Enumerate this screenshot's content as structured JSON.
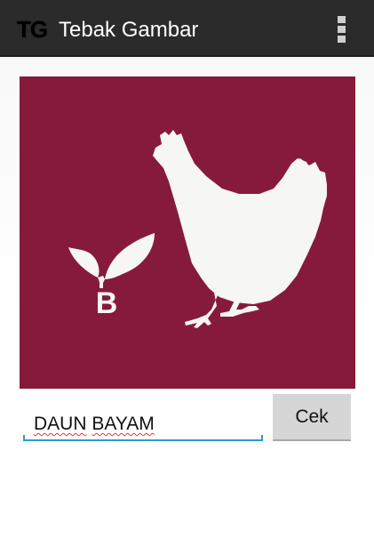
{
  "action_bar": {
    "logo_text": "TG",
    "title": "Tebak Gambar",
    "overflow_icon": "overflow-menu-icon"
  },
  "puzzle": {
    "background_color": "#861a3b",
    "foreground_color": "#f6f6f2",
    "illustration": [
      "chicken",
      "leaf-sprout"
    ],
    "letter": "B"
  },
  "answer": {
    "words": [
      "DAUN",
      "BAYAM"
    ]
  },
  "check_button": {
    "label": "Cek"
  },
  "colors": {
    "action_bar": "#2b2b2b",
    "input_underline": "#2b9bd2",
    "spellcheck_underline": "#e53935",
    "button": "#d6d6d6"
  }
}
